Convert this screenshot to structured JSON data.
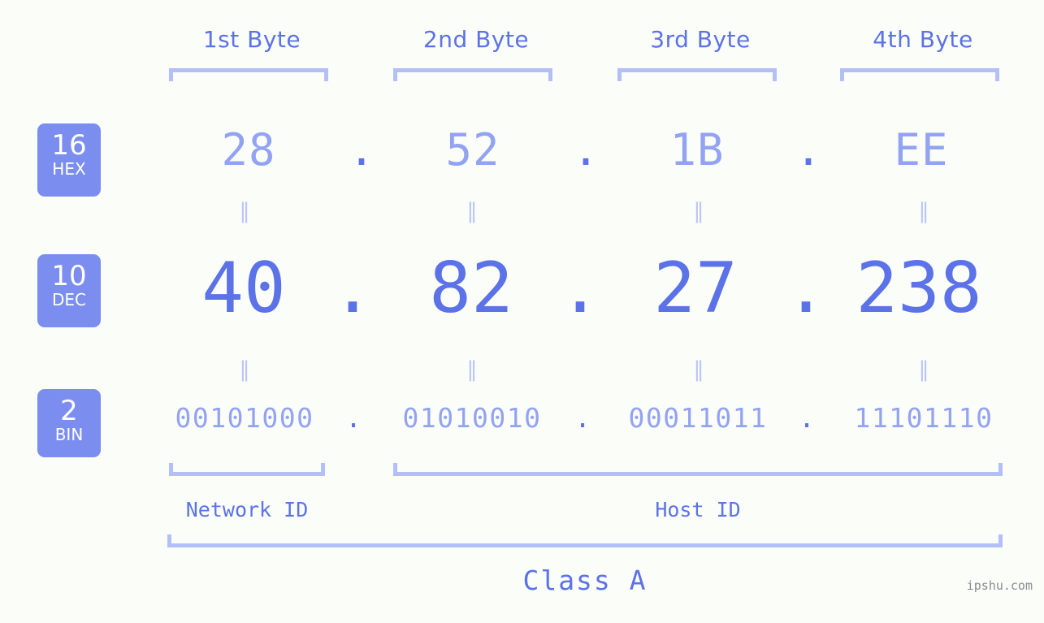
{
  "page": {
    "background_color": "#fbfdf8",
    "accent_color": "#5b72e8",
    "accent_light_color": "#93a3f3",
    "bracket_color": "#b4bffa",
    "badge_color": "#7b8ef0",
    "watermark": "ipshu.com"
  },
  "byte_headers": [
    {
      "label": "1st Byte"
    },
    {
      "label": "2nd Byte"
    },
    {
      "label": "3rd Byte"
    },
    {
      "label": "4th Byte"
    }
  ],
  "bases": [
    {
      "number": "16",
      "name": "HEX"
    },
    {
      "number": "10",
      "name": "DEC"
    },
    {
      "number": "2",
      "name": "BIN"
    }
  ],
  "rows": {
    "hex": {
      "base": "16",
      "base_name": "HEX",
      "values": [
        "28",
        "52",
        "1B",
        "EE"
      ]
    },
    "dec": {
      "base": "10",
      "base_name": "DEC",
      "values": [
        "40",
        "82",
        "27",
        "238"
      ]
    },
    "bin": {
      "base": "2",
      "base_name": "BIN",
      "values": [
        "00101000",
        "01010010",
        "00011011",
        "11101110"
      ]
    }
  },
  "separators": {
    "dot": ".",
    "equals": "‖"
  },
  "ranges": {
    "network_id": "Network ID",
    "host_id": "Host ID",
    "class": "Class A"
  },
  "ip_address": {
    "dotted_decimal": "40.82.27.238",
    "hex": "28.52.1B.EE",
    "binary": "00101000.01010010.00011011.11101110"
  }
}
